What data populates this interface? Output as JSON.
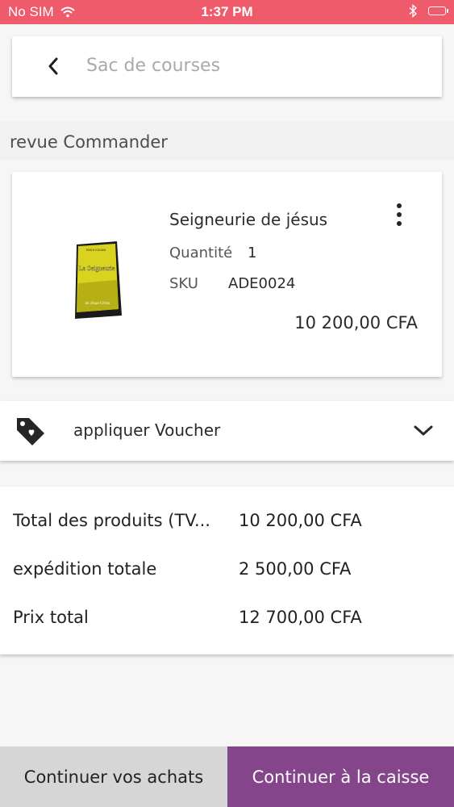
{
  "status_bar": {
    "carrier": "No SIM",
    "time": "1:37 PM",
    "wifi_icon": "wifi-icon",
    "bluetooth_icon": "bluetooth-icon",
    "battery_icon": "battery-icon"
  },
  "header": {
    "back_icon": "chevron-left-icon",
    "title": "Sac de courses"
  },
  "section": {
    "title": "revue Commander"
  },
  "product": {
    "name": "Seigneurie de jésus",
    "quantity_label": "Quantité",
    "quantity_value": "1",
    "sku_label": "SKU",
    "sku_value": "ADE0024",
    "price": "10 200,00 CFA",
    "cover_title": "La Seigneurie",
    "cover_subtitle": "de Jésus-Christ",
    "cover_author": "EMILE KOUAM"
  },
  "voucher": {
    "label": "appliquer Voucher",
    "icon": "tag-icon",
    "chevron": "chevron-down-icon"
  },
  "totals": {
    "rows": [
      {
        "label": "Total des produits (TV...",
        "value": "10 200,00 CFA"
      },
      {
        "label": "expédition totale",
        "value": "2 500,00 CFA"
      },
      {
        "label": "Prix total",
        "value": "12 700,00 CFA"
      }
    ]
  },
  "actions": {
    "continue_shopping": "Continuer vos achats",
    "checkout": "Continuer à la caisse"
  },
  "colors": {
    "status_bar": "#ef5b6b",
    "checkout_button": "#85458a",
    "secondary_button": "#d6d6d6"
  }
}
